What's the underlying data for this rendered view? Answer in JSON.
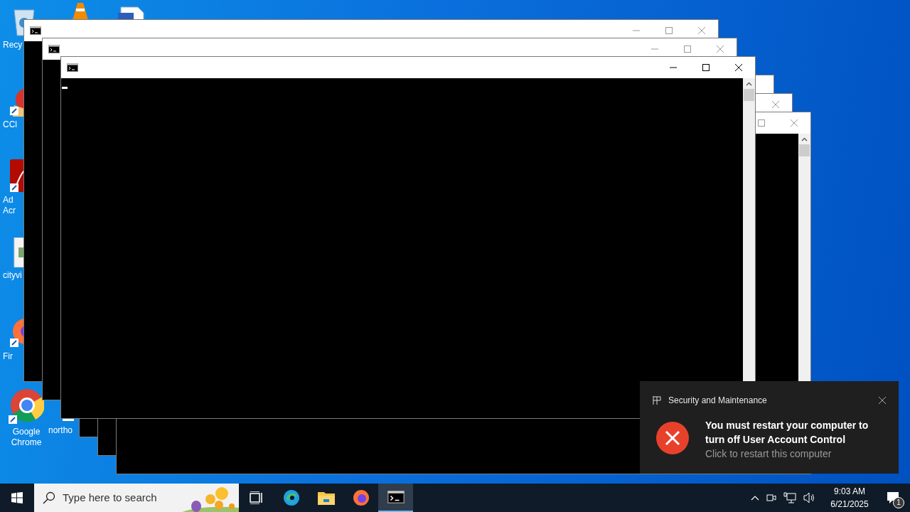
{
  "desktop_icons": [
    {
      "kind": "bin",
      "label_lines": [
        "Recy"
      ]
    },
    {
      "kind": "cone"
    },
    {
      "kind": "document"
    },
    {
      "kind": "ccleaner",
      "label_lines": [
        "CCl"
      ]
    },
    {
      "kind": "acrobat",
      "label_lines": [
        "Ad",
        "Acr"
      ]
    },
    {
      "kind": "image",
      "label_lines": [
        "cityvi"
      ]
    },
    {
      "kind": "firefox",
      "label_lines": [
        "Fir"
      ]
    },
    {
      "kind": "chrome",
      "label_lines": [
        "Google",
        "Chrome"
      ]
    },
    {
      "kind": "file",
      "label_lines": [
        "northo"
      ]
    }
  ],
  "windows": [
    {
      "active": false
    },
    {
      "active": false
    },
    {
      "active": true
    },
    {
      "active": false
    },
    {
      "active": false
    },
    {
      "active": false
    }
  ],
  "taskbar": {
    "search": {
      "placeholder": "Type here to search"
    },
    "apps": [
      {
        "kind": "taskview",
        "selected": false
      },
      {
        "kind": "edge",
        "selected": false
      },
      {
        "kind": "explorer",
        "selected": false
      },
      {
        "kind": "firefox",
        "selected": false
      },
      {
        "kind": "cmd",
        "selected": true
      }
    ],
    "time": "9:03 AM",
    "date": "6/21/2025",
    "notification_count": "1"
  },
  "toast": {
    "app": "Security and Maintenance",
    "title": "You must restart your computer to turn off User Account Control",
    "body": "Click to restart this computer"
  }
}
